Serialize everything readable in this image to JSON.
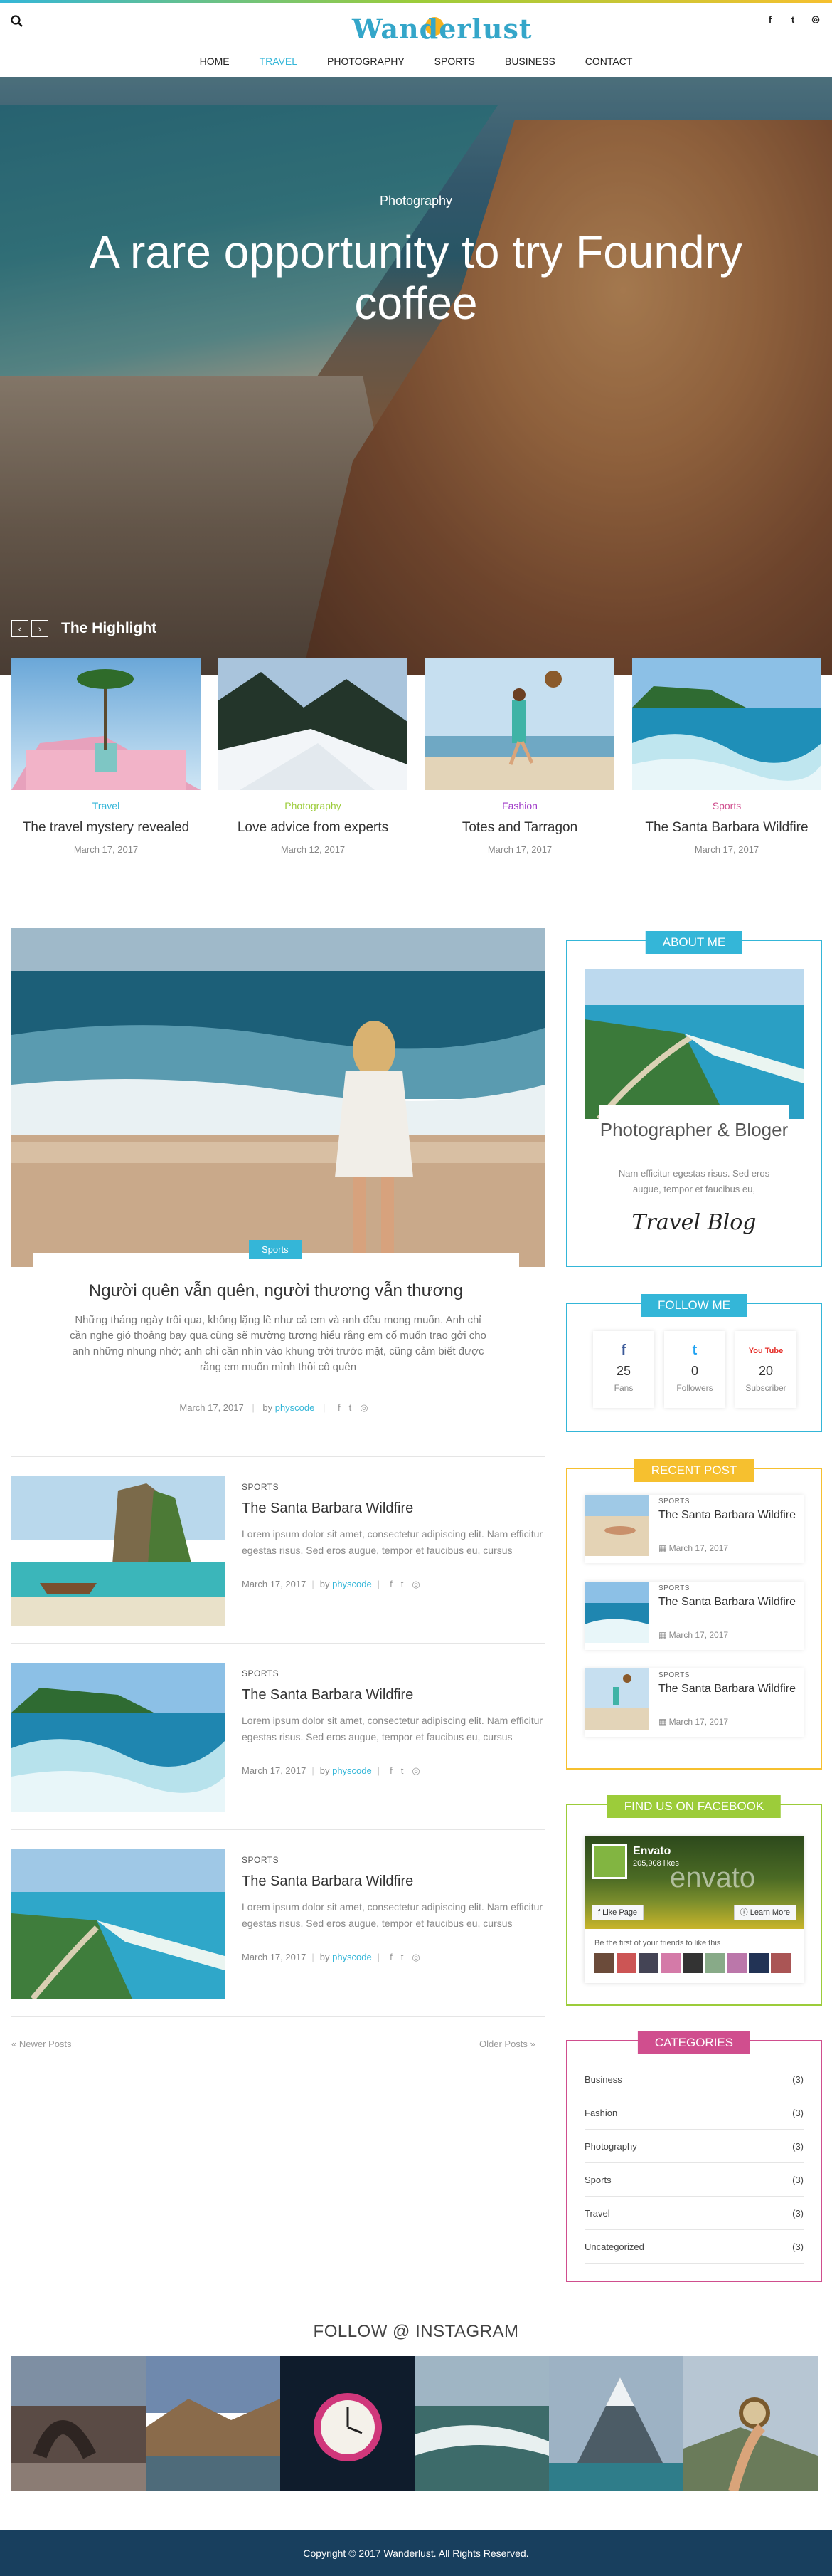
{
  "header": {
    "logo_text": "Wanderlust",
    "nav": [
      "HOME",
      "TRAVEL",
      "PHOTOGRAPHY",
      "SPORTS",
      "BUSINESS",
      "CONTACT"
    ],
    "active_nav": "TRAVEL",
    "social_icons": [
      "facebook-icon",
      "twitter-icon",
      "instagram-icon"
    ],
    "social_glyphs": [
      "f",
      "t",
      "◎"
    ]
  },
  "hero": {
    "category": "Photography",
    "title": "A rare opportunity to try Foundry coffee"
  },
  "highlight": {
    "title": "The Highlight",
    "prev": "‹",
    "next": "›",
    "cards": [
      {
        "category": "Travel",
        "title": "The travel mystery revealed",
        "date": "March 17, 2017",
        "color": "#34b6d8"
      },
      {
        "category": "Photography",
        "title": "Love advice from experts",
        "date": "March 12, 2017",
        "color": "#9ccc3a"
      },
      {
        "category": "Fashion",
        "title": "Totes and Tarragon",
        "date": "March 17, 2017",
        "color": "#a03cc8"
      },
      {
        "category": "Sports",
        "title": "The Santa Barbara Wildfire",
        "date": "March 17, 2017",
        "color": "#d04e8e"
      }
    ]
  },
  "featured": {
    "category": "Sports",
    "title": "Người quên vẫn quên, người thương vẫn thương",
    "excerpt": "Những tháng ngày trôi qua, không lặng lẽ như cả em và anh đều mong muốn. Anh chỉ cần nghe gió thoảng bay qua cũng sẽ mường tượng hiểu rằng em cố muốn trao gởi cho anh những nhung nhớ; anh chỉ cần nhìn vào khung trời trước mặt, cũng cảm biết được rằng em muốn mình thôi cô quên",
    "date": "March 17, 2017",
    "by": "by",
    "author": "physcode"
  },
  "posts": [
    {
      "category": "SPORTS",
      "title": "The Santa Barbara Wildfire",
      "excerpt": "Lorem ipsum dolor sit amet, consectetur adipiscing elit. Nam efficitur egestas risus. Sed eros augue, tempor et faucibus eu, cursus",
      "date": "March 17, 2017",
      "by": "by",
      "author": "physcode"
    },
    {
      "category": "SPORTS",
      "title": "The Santa Barbara Wildfire",
      "excerpt": "Lorem ipsum dolor sit amet, consectetur adipiscing elit. Nam efficitur egestas risus. Sed eros augue, tempor et faucibus eu, cursus",
      "date": "March 17, 2017",
      "by": "by",
      "author": "physcode"
    },
    {
      "category": "SPORTS",
      "title": "The Santa Barbara Wildfire",
      "excerpt": "Lorem ipsum dolor sit amet, consectetur adipiscing elit. Nam efficitur egestas risus. Sed eros augue, tempor et faucibus eu, cursus",
      "date": "March 17, 2017",
      "by": "by",
      "author": "physcode"
    }
  ],
  "pager": {
    "newer": "«  Newer Posts",
    "older": "Older Posts  »"
  },
  "about": {
    "title": "ABOUT ME",
    "name": "Photographer & Bloger",
    "text": "Nam efficitur egestas risus. Sed eros augue, tempor et faucibus eu,",
    "signature": "Travel Blog",
    "color": "#34b6d8"
  },
  "follow": {
    "title": "FOLLOW ME",
    "color": "#34b6d8",
    "items": [
      {
        "icon": "facebook-icon",
        "glyph": "f",
        "count": "25",
        "label": "Fans",
        "color": "#3b5998"
      },
      {
        "icon": "twitter-icon",
        "glyph": "t",
        "count": "0",
        "label": "Followers",
        "color": "#1da1f2"
      },
      {
        "icon": "youtube-icon",
        "glyph": "You Tube",
        "count": "20",
        "label": "Subscriber",
        "color": "#e52d27"
      }
    ]
  },
  "recent": {
    "title": "RECENT POST",
    "color": "#f6c02f",
    "items": [
      {
        "category": "SPORTS",
        "title": "The Santa Barbara Wildfire",
        "date": "March 17, 2017"
      },
      {
        "category": "SPORTS",
        "title": "The Santa Barbara Wildfire",
        "date": "March 17, 2017"
      },
      {
        "category": "SPORTS",
        "title": "The Santa Barbara Wildfire",
        "date": "March 17, 2017"
      }
    ]
  },
  "facebook": {
    "title": "FIND US ON FACEBOOK",
    "color": "#9ccc3a",
    "page_name": "Envato",
    "likes": "205,908 likes",
    "brand": "envato",
    "like_button": "Like Page",
    "learn_button": "Learn More",
    "friends_text": "Be the first of your friends to like this"
  },
  "categories": {
    "title": "CATEGORIES",
    "color": "#d04e8e",
    "items": [
      {
        "name": "Business",
        "count": "(3)"
      },
      {
        "name": "Fashion",
        "count": "(3)"
      },
      {
        "name": "Photography",
        "count": "(3)"
      },
      {
        "name": "Sports",
        "count": "(3)"
      },
      {
        "name": "Travel",
        "count": "(3)"
      },
      {
        "name": "Uncategorized",
        "count": "(3)"
      }
    ]
  },
  "instagram": {
    "title": "FOLLOW @ INSTAGRAM"
  },
  "footer": {
    "copyright": "Copyright © 2017 Wanderlust. All Rights Reserved."
  }
}
